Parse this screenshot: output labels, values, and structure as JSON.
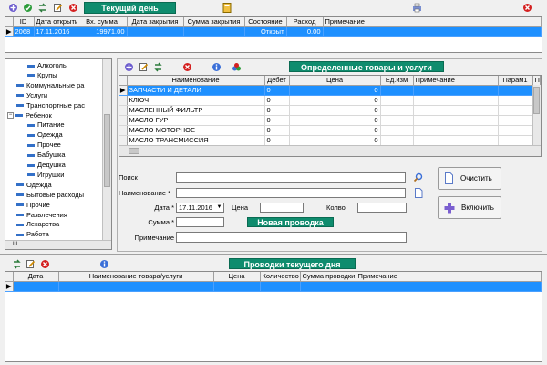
{
  "top_toolbar": {
    "title": "Текущий день"
  },
  "days_grid": {
    "columns": [
      "ID",
      "Дата открытия",
      "Вх. сумма",
      "Дата закрытия",
      "Сумма закрытия",
      "Состояние",
      "Расход",
      "Примечание"
    ],
    "rows": [
      {
        "id": "2068",
        "open_date": "17.11.2016",
        "in_sum": "19971.00",
        "close_date": "",
        "close_sum": "",
        "state": "Открыт",
        "expense": "0.00",
        "note": ""
      }
    ]
  },
  "tree": {
    "items": [
      {
        "label": "Алкоголь",
        "level": 2,
        "type": "leaf"
      },
      {
        "label": "Крупы",
        "level": 2,
        "type": "leaf"
      },
      {
        "label": "Коммунальные ра",
        "level": 1,
        "type": "leaf"
      },
      {
        "label": "Услуги",
        "level": 1,
        "type": "leaf"
      },
      {
        "label": "Транспортные рас",
        "level": 1,
        "type": "leaf"
      },
      {
        "label": "Ребенок",
        "level": 1,
        "type": "expanded"
      },
      {
        "label": "Питание",
        "level": 2,
        "type": "leaf"
      },
      {
        "label": "Одежда",
        "level": 2,
        "type": "leaf"
      },
      {
        "label": "Прочее",
        "level": 2,
        "type": "leaf"
      },
      {
        "label": "Бабушка",
        "level": 2,
        "type": "leaf"
      },
      {
        "label": "Дедушка",
        "level": 2,
        "type": "leaf"
      },
      {
        "label": "Игрушки",
        "level": 2,
        "type": "leaf"
      },
      {
        "label": "Одежда",
        "level": 1,
        "type": "leaf"
      },
      {
        "label": "Бытовые расходы",
        "level": 1,
        "type": "leaf"
      },
      {
        "label": "Прочие",
        "level": 1,
        "type": "leaf"
      },
      {
        "label": "Развлечения",
        "level": 1,
        "type": "leaf"
      },
      {
        "label": "Лекарства",
        "level": 1,
        "type": "leaf"
      },
      {
        "label": "Работа",
        "level": 1,
        "type": "leaf"
      }
    ],
    "hscroll_glyph": "III"
  },
  "goods": {
    "title": "Определенные товары и услуги",
    "columns": [
      "Наименование",
      "Дебет",
      "Цена",
      "Ед.изм",
      "Примечание",
      "Парам1",
      "Па"
    ],
    "rows": [
      {
        "name": "ЗАПЧАСТИ И ДЕТАЛИ",
        "debit": "0",
        "price": "0",
        "selected": true
      },
      {
        "name": "КЛЮЧ",
        "debit": "0",
        "price": "0",
        "selected": false
      },
      {
        "name": "МАСЛЕННЫЙ ФИЛЬТР",
        "debit": "0",
        "price": "0",
        "selected": false
      },
      {
        "name": "МАСЛО ГУР",
        "debit": "0",
        "price": "0",
        "selected": false
      },
      {
        "name": "МАСЛО МОТОРНОЕ",
        "debit": "0",
        "price": "0",
        "selected": false
      },
      {
        "name": "МАСЛО ТРАНСМИССИЯ",
        "debit": "0",
        "price": "0",
        "selected": false
      }
    ]
  },
  "form": {
    "search_label": "Поиск",
    "name_label": "Наименование *",
    "date_label": "Дата *",
    "date_value": "17.11.2016",
    "price_label": "Цена",
    "qty_label": "Колво",
    "sum_label": "Сумма *",
    "note_label": "Примечание",
    "new_entry_title": "Новая проводка",
    "clear_button": "Очистить",
    "include_button": "Включить"
  },
  "entries": {
    "title": "Проводки текущего дня",
    "columns": [
      "Дата",
      "Наименование товара/услуги",
      "Цена",
      "Количество",
      "Сумма проводки",
      "Примечание"
    ]
  },
  "colors": {
    "accent_green": "#0f8c6e",
    "selection_blue": "#1e90ff"
  }
}
